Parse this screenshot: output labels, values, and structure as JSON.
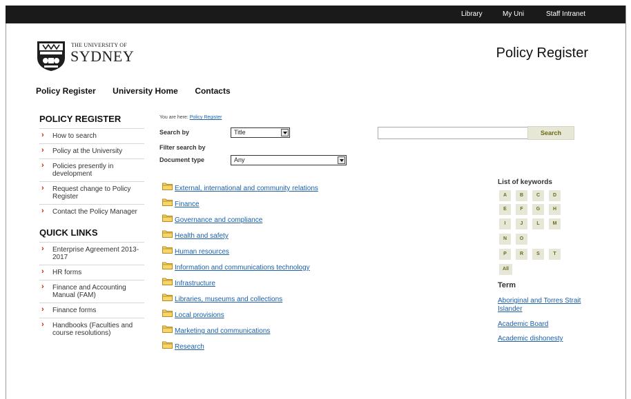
{
  "topbar": {
    "links": [
      "Library",
      "My Uni",
      "Staff Intranet"
    ]
  },
  "header": {
    "logo_small": "THE UNIVERSITY OF",
    "logo_big": "SYDNEY",
    "site_title": "Policy Register"
  },
  "mainnav": {
    "items": [
      "Policy Register",
      "University Home",
      "Contacts"
    ]
  },
  "sidebar": {
    "policy_heading": "POLICY REGISTER",
    "policy_items": [
      "How to search",
      "Policy at the University",
      "Policies presently in development",
      "Request change to Policy Register",
      "Contact the Policy Manager"
    ],
    "quick_heading": "QUICK LINKS",
    "quick_items": [
      "Enterprise Agreement 2013-2017",
      "HR forms",
      "Finance and Accounting Manual (FAM)",
      "Finance forms",
      "Handbooks (Faculties and course resolutions)"
    ]
  },
  "breadcrumb": {
    "prefix": "You are here: ",
    "link": "Policy Register"
  },
  "search": {
    "search_by_label": "Search by",
    "search_by_value": "Title",
    "filter_label": "Filter search by",
    "doctype_label": "Document type",
    "doctype_value": "Any",
    "input_value": "",
    "button_label": "Search"
  },
  "categories": [
    "External, international and community relations",
    "Finance",
    "Governance and compliance",
    "Health and safety",
    "Human resources",
    "Information and communications technology",
    "Infrastructure",
    "Libraries, museums and collections",
    "Local provisions",
    "Marketing and communications",
    "Research"
  ],
  "keywords": {
    "heading": "List of keywords",
    "letters": [
      "A",
      "B",
      "C",
      "D",
      "E",
      "F",
      "G",
      "H",
      "I",
      "J",
      "L",
      "M",
      "N",
      "O",
      "P",
      "R",
      "S",
      "T",
      "All"
    ]
  },
  "terms": {
    "heading": "Term",
    "items": [
      "Aboriginal and Torres Strait Islander",
      "Academic Board",
      "Academic dishonesty"
    ]
  },
  "colors": {
    "link": "#1a5fa8",
    "chevron": "#cc2200",
    "topbar": "#1a1a1a",
    "button_bg": "#e7e7d7",
    "button_text": "#6b6b1a"
  }
}
